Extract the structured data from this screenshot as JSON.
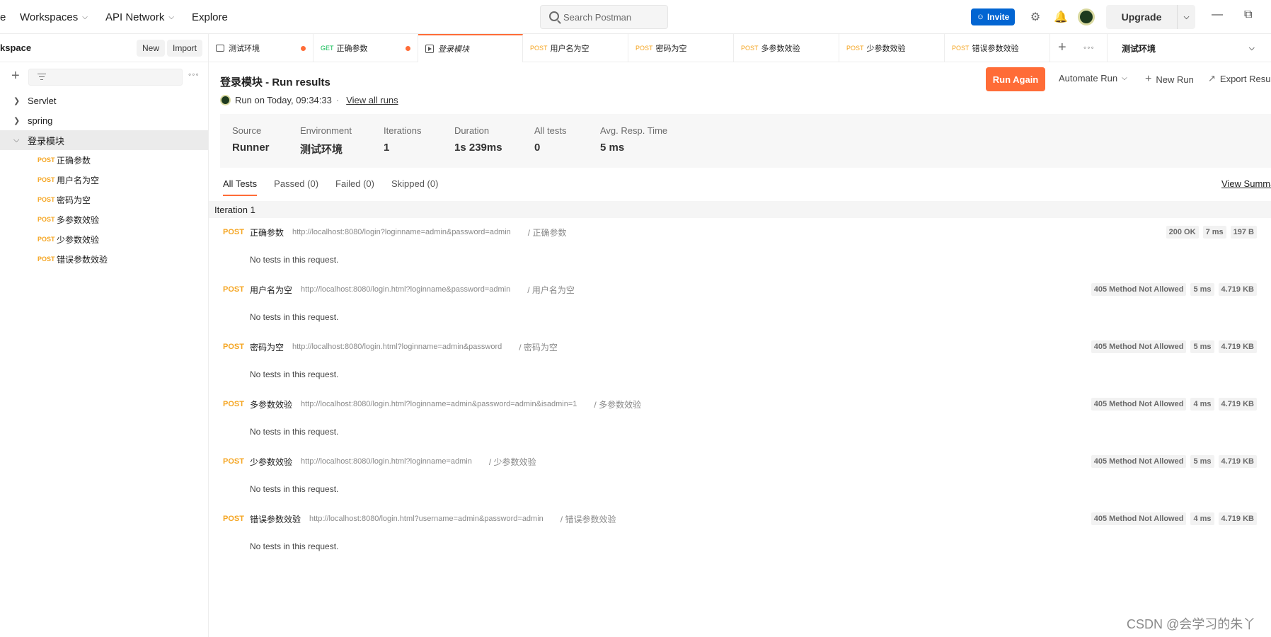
{
  "topbar": {
    "nav": [
      "e",
      "Workspaces",
      "API Network",
      "Explore"
    ],
    "search_placeholder": "Search Postman",
    "invite_label": "Invite",
    "upgrade_label": "Upgrade"
  },
  "sidebar": {
    "title": "kspace",
    "new_label": "New",
    "import_label": "Import",
    "folders": [
      {
        "label": "Servlet",
        "expanded": false
      },
      {
        "label": "spring",
        "expanded": false
      },
      {
        "label": "登录模块",
        "expanded": true
      }
    ],
    "requests": [
      {
        "method": "POST",
        "name": "正确参数"
      },
      {
        "method": "POST",
        "name": "用户名为空"
      },
      {
        "method": "POST",
        "name": "密码为空"
      },
      {
        "method": "POST",
        "name": "多参数效验"
      },
      {
        "method": "POST",
        "name": "少参数效验"
      },
      {
        "method": "POST",
        "name": "错误参数效验"
      }
    ]
  },
  "tabs": [
    {
      "method": "",
      "label": "测试环境",
      "dot": true
    },
    {
      "method": "GET",
      "label": "正确参数",
      "dot": true
    },
    {
      "method": "",
      "label": "登录模块",
      "active": true
    },
    {
      "method": "POST",
      "label": "用户名为空"
    },
    {
      "method": "POST",
      "label": "密码为空"
    },
    {
      "method": "POST",
      "label": "多参数效验"
    },
    {
      "method": "POST",
      "label": "少参数效验"
    },
    {
      "method": "POST",
      "label": "错误参数效验"
    }
  ],
  "environment": "测试环境",
  "run": {
    "title": "登录模块 - Run results",
    "meta": "Run on Today, 09:34:33",
    "sep": "·",
    "view_all": "View all runs",
    "run_again": "Run Again",
    "automate": "Automate Run",
    "new_run": "New Run",
    "export": "Export Resu",
    "stats": [
      {
        "k": "Source",
        "v": "Runner"
      },
      {
        "k": "Environment",
        "v": "测试环境"
      },
      {
        "k": "Iterations",
        "v": "1"
      },
      {
        "k": "Duration",
        "v": "1s 239ms"
      },
      {
        "k": "All tests",
        "v": "0"
      },
      {
        "k": "Avg. Resp. Time",
        "v": "5 ms"
      }
    ],
    "filters": [
      "All Tests",
      "Passed (0)",
      "Failed (0)",
      "Skipped (0)"
    ],
    "view_summary": "View Summa",
    "iteration_label": "Iteration 1",
    "no_tests": "No tests in this request.",
    "results": [
      {
        "method": "POST",
        "name": "正确参数",
        "url": "http://localhost:8080/login?loginname=admin&password=admin",
        "path": "/ 正确参数",
        "status": "200 OK",
        "time": "7 ms",
        "size": "197 B"
      },
      {
        "method": "POST",
        "name": "用户名为空",
        "url": "http://localhost:8080/login.html?loginname&password=admin",
        "path": "/ 用户名为空",
        "status": "405 Method Not Allowed",
        "time": "5 ms",
        "size": "4.719 KB"
      },
      {
        "method": "POST",
        "name": "密码为空",
        "url": "http://localhost:8080/login.html?loginname=admin&password",
        "path": "/ 密码为空",
        "status": "405 Method Not Allowed",
        "time": "5 ms",
        "size": "4.719 KB"
      },
      {
        "method": "POST",
        "name": "多参数效验",
        "url": "http://localhost:8080/login.html?loginname=admin&password=admin&isadmin=1",
        "path": "/ 多参数效验",
        "status": "405 Method Not Allowed",
        "time": "4 ms",
        "size": "4.719 KB"
      },
      {
        "method": "POST",
        "name": "少参数效验",
        "url": "http://localhost:8080/login.html?loginname=admin",
        "path": "/ 少参数效验",
        "status": "405 Method Not Allowed",
        "time": "5 ms",
        "size": "4.719 KB"
      },
      {
        "method": "POST",
        "name": "错误参数效验",
        "url": "http://localhost:8080/login.html?username=admin&password=admin",
        "path": "/ 错误参数效验",
        "status": "405 Method Not Allowed",
        "time": "4 ms",
        "size": "4.719 KB"
      }
    ]
  },
  "watermark": "CSDN @会学习的朱丫",
  "colors": {
    "accent": "#ff6c37",
    "invite": "#0265d2",
    "post": "#f5a623"
  },
  "icons": [
    "search-icon",
    "settings-icon",
    "bell-icon",
    "avatar",
    "minimize-icon",
    "restore-icon",
    "plus-icon",
    "filter-icon",
    "more-icon",
    "chevron-down-icon",
    "chevron-right-icon",
    "runner-icon",
    "environment-icon"
  ]
}
